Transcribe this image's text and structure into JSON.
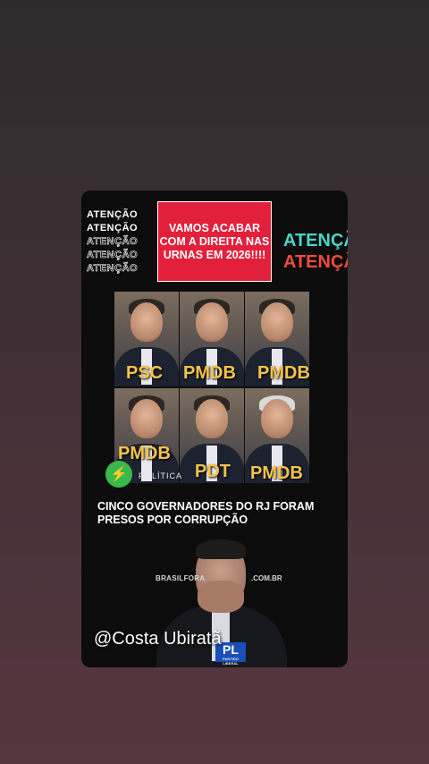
{
  "post": {
    "attention_left": [
      "ATENÇÃO",
      "ATENÇÃO",
      "ATENÇÃO",
      "ATENÇÃO",
      "ATENÇÃO"
    ],
    "attention_right": [
      "ATENÇÃ",
      "ATENÇÃ"
    ],
    "headline": "VAMOS ACABAR COM A DIREITA NAS URNAS EM 2026!!!!",
    "parties": [
      "PSC",
      "PMDB",
      "PMDB",
      "PMDB",
      "PDT",
      "PMDB"
    ],
    "logo_icon": "bolt-in-circle-icon",
    "logo_text": "POLÍTICA",
    "caption": "CINCO GOVERNADORES DO RJ FORAM PRESOS POR CORRUPÇÃO",
    "site_left": "BRASILFORA",
    "site_right": ".COM.BR",
    "pl_badge": "PL",
    "pl_sub": "PARTIDO LIBERAL",
    "username": "@Costa Ubiratã"
  }
}
